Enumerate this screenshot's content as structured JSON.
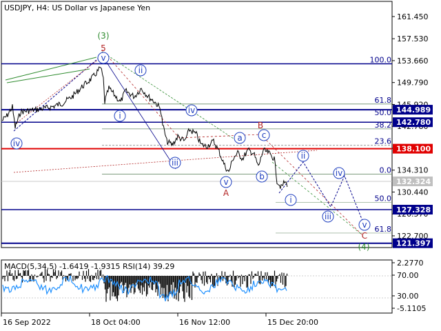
{
  "header": {
    "symbol": "USDJPY",
    "timeframe": "H4",
    "description": "US Dollar vs Japanese Yen",
    "title_text": "USDJPY, H4:  US Dollar vs Japanese Yen"
  },
  "price_axis": {
    "ticks": [
      "161.450",
      "157.530",
      "153.660",
      "149.790",
      "145.920",
      "142.780",
      "138.100",
      "134.310",
      "130.440",
      "126.570",
      "122.700"
    ],
    "tick_values": [
      161.45,
      157.53,
      153.66,
      149.79,
      145.92,
      142.05,
      138.18,
      134.31,
      130.44,
      126.57,
      122.7
    ]
  },
  "price_tags": [
    {
      "label": "144.989",
      "value": 144.989,
      "color": "#00008b"
    },
    {
      "label": "142.780",
      "value": 142.78,
      "color": "#00008b"
    },
    {
      "label": "138.100",
      "value": 138.1,
      "color": "#e00000"
    },
    {
      "label": "132.324",
      "value": 132.324,
      "color": "#c0c0c0"
    },
    {
      "label": "127.328",
      "value": 127.328,
      "color": "#00008b"
    },
    {
      "label": "121.397",
      "value": 121.397,
      "color": "#00008b"
    }
  ],
  "fib_levels": [
    {
      "label": "100.0",
      "value": 153.1
    },
    {
      "label": "61.8",
      "value": 146.0
    },
    {
      "label": "50.0",
      "value": 143.8
    },
    {
      "label": "38.2",
      "value": 141.6
    },
    {
      "label": "23.6",
      "value": 138.7
    },
    {
      "label": "0.0",
      "value": 133.6
    },
    {
      "label": "50.0",
      "value": 128.6
    },
    {
      "label": "61.8",
      "value": 123.2
    }
  ],
  "wave_labels": [
    {
      "text": "(3)",
      "color": "#2e8b2e"
    },
    {
      "text": "5",
      "color": "#b22222"
    },
    {
      "text": "v",
      "color": "#1f3fbf"
    },
    {
      "text": "ii",
      "color": "#1f3fbf"
    },
    {
      "text": "i",
      "color": "#1f3fbf"
    },
    {
      "text": "iv",
      "color": "#1f3fbf"
    },
    {
      "text": "iii",
      "color": "#1f3fbf"
    },
    {
      "text": "a",
      "color": "#1f3fbf"
    },
    {
      "text": "B",
      "color": "#b22222"
    },
    {
      "text": "c",
      "color": "#1f3fbf"
    },
    {
      "text": "b",
      "color": "#1f3fbf"
    },
    {
      "text": "v",
      "color": "#1f3fbf"
    },
    {
      "text": "A",
      "color": "#b22222"
    },
    {
      "text": "ii",
      "color": "#1f3fbf"
    },
    {
      "text": "i",
      "color": "#1f3fbf"
    },
    {
      "text": "iv",
      "color": "#1f3fbf"
    },
    {
      "text": "iii",
      "color": "#1f3fbf"
    },
    {
      "text": "v",
      "color": "#1f3fbf"
    },
    {
      "text": "C",
      "color": "#b22222"
    },
    {
      "text": "(4)",
      "color": "#2e8b2e"
    },
    {
      "text": "iv",
      "color": "#1f3fbf"
    }
  ],
  "indicator": {
    "title_text": "MACD(5,34,5) -1.6419 -1.9315 RSI(14) 39.29",
    "axis_ticks": [
      "2.2770",
      "70.00",
      "30.00",
      "-5.1105"
    ]
  },
  "time_axis": {
    "ticks": [
      "16 Sep 2022",
      "18 Oct 04:00",
      "16 Nov 12:00",
      "15 Dec 20:00"
    ]
  },
  "colors": {
    "price_line": "#000000",
    "level_blue": "#00008b",
    "level_red": "#e00000",
    "wave_blue": "#1f3fbf",
    "wave_green": "#2e8b2e",
    "wave_red": "#b22222",
    "rsi": "#1e90ff"
  }
}
